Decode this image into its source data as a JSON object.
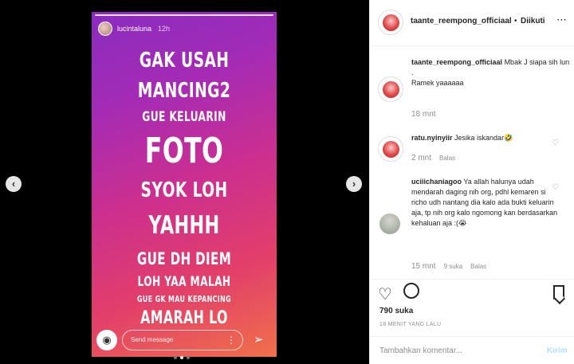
{
  "story": {
    "username": "lucintaluna",
    "time": "12h",
    "lines": [
      "GAK USAH",
      "MANCING2",
      "GUE KELUARIN",
      "FOTO",
      "SYOK LOH",
      "YAHHH",
      "GUE DH DIEM",
      "LOH YAA MALAH",
      "GUE GK MAU KEPANCING",
      "AMARAH LO"
    ],
    "message_placeholder": "Send message",
    "more_icon": "⋮",
    "camera_icon": "◉",
    "send_icon": "➢"
  },
  "nav": {
    "prev": "‹",
    "next": "›"
  },
  "header": {
    "username": "taante_reempong_officiaal",
    "separator": "•",
    "follow": "Diikuti",
    "more": "⋯"
  },
  "comments": [
    {
      "username": "taante_reempong_officiaal",
      "text_lines": [
        "Mbak J siapa sih lun",
        ".",
        "Ramek yaaaaaa"
      ],
      "time": "18 mnt"
    },
    {
      "username": "ratu.nyinyiir",
      "text": "Jesika iskandar🤣",
      "time": "2 mnt",
      "reply": "Balas"
    },
    {
      "username": "uciiichaniagoo",
      "text": "Ya allah halunya udah mendarah daging nih org, pdhl kemaren si richo udh nantang dia kalo ada bukti keluarin aja, tp nih org kalo ngomong kan berdasarkan kehaluan aja :(😭",
      "time": "15 mnt",
      "likes": "9 suka",
      "reply": "Balas"
    }
  ],
  "actions": {
    "likes": "790 suka",
    "time_ago": "18 MENIT YANG LALU",
    "heart_icon": "♡"
  },
  "add_comment": {
    "placeholder": "Tambahkan komentar...",
    "send": "Kirim"
  }
}
